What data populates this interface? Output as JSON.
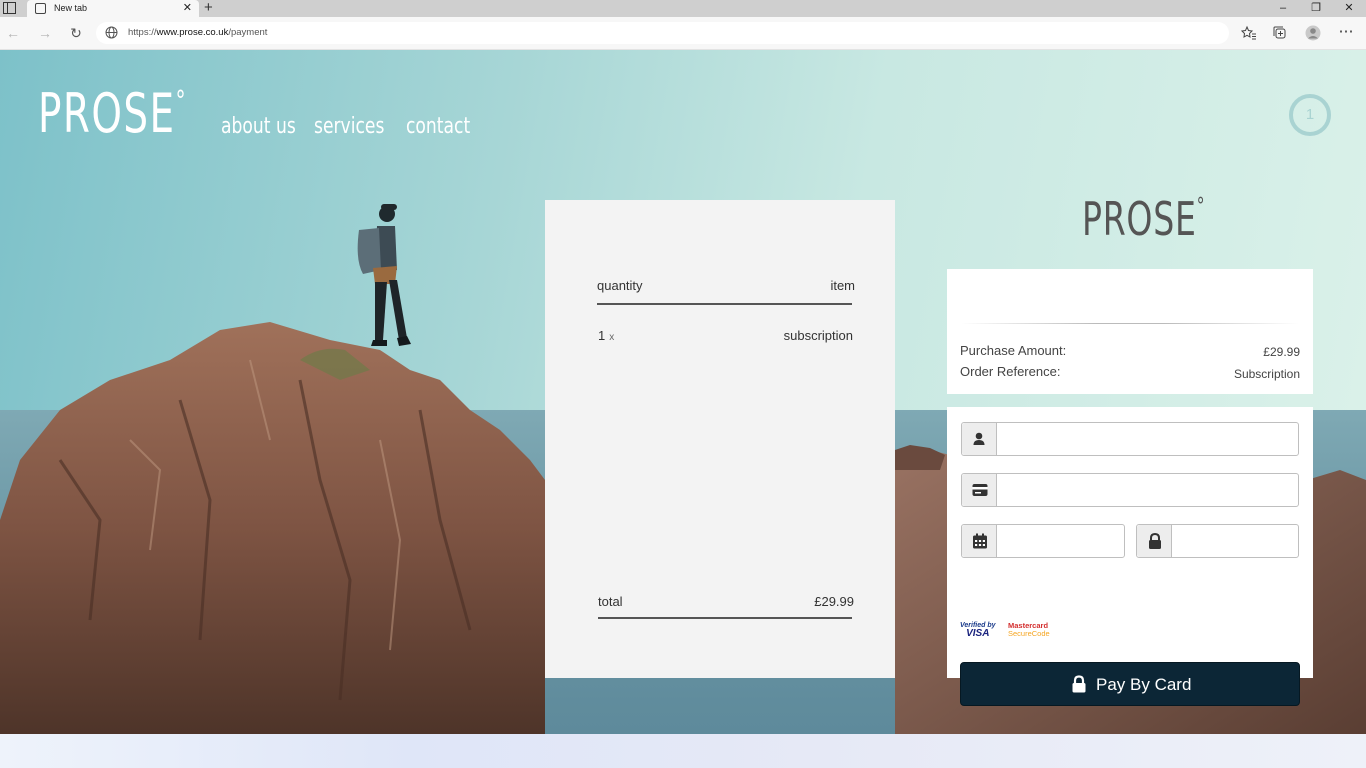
{
  "browser": {
    "tab_title": "New tab",
    "url_prefix": "https://",
    "url_host": "www.prose.co.uk",
    "url_path": "/payment"
  },
  "site": {
    "logo": "PROSE",
    "logo_degree": "°",
    "nav": [
      "about us",
      "services",
      "contact"
    ],
    "cart_count": "1"
  },
  "summary": {
    "col_quantity": "quantity",
    "col_item": "item",
    "row_qty": "1",
    "row_x": "x",
    "row_item": "subscription",
    "total_label": "total",
    "total_value": "£29.99"
  },
  "payment": {
    "logo": "PROSE",
    "logo_degree": "°",
    "purchase_label": "Purchase Amount:",
    "purchase_value": "£29.99",
    "reference_label": "Order Reference:",
    "reference_value": "Subscription",
    "name_value": "",
    "card_value": "",
    "expiry_value": "",
    "cvv_value": "",
    "verified_line1": "Verified by",
    "verified_line2": "VISA",
    "mastercard_line1": "Mastercard",
    "mastercard_line2": "SecureCode",
    "pay_button": "Pay By Card"
  },
  "icons": {
    "name_field": "person-icon",
    "card_field": "credit-card-icon",
    "expiry_field": "calendar-icon",
    "cvv_field": "lock-icon",
    "pay_button": "lock-icon"
  },
  "colors": {
    "pay_button_bg": "#0c2636",
    "summary_bg": "#f3f3f3",
    "logo_dark": "#555555",
    "cart_ring": "#a9d3d2"
  }
}
